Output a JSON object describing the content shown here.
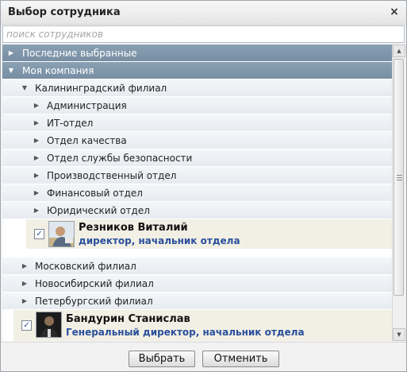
{
  "dialog": {
    "title": "Выбор сотрудника",
    "close_glyph": "×"
  },
  "search": {
    "placeholder": "поиск сотрудников",
    "value": ""
  },
  "tree": {
    "recent": {
      "label": "Последние выбранные",
      "expanded": false
    },
    "company": {
      "label": "Моя компания",
      "expanded": true
    },
    "kaliningrad": {
      "label": "Калининградский филиал",
      "expanded": true,
      "departments": [
        {
          "label": "Администрация"
        },
        {
          "label": "ИТ-отдел"
        },
        {
          "label": "Отдел качества"
        },
        {
          "label": "Отдел службы безопасности"
        },
        {
          "label": "Производственный отдел"
        },
        {
          "label": "Финансовый отдел"
        },
        {
          "label": "Юридический отдел"
        }
      ],
      "head": {
        "name": "Резников Виталий",
        "position": "директор, начальник отдела",
        "checked": true
      }
    },
    "branches": [
      {
        "label": "Московский филиал"
      },
      {
        "label": "Новосибирский филиал"
      },
      {
        "label": "Петербургский филиал"
      }
    ],
    "company_head": {
      "name": "Бандурин Станислав",
      "position": "Генеральный директор, начальник отдела",
      "checked": true
    }
  },
  "footer": {
    "select_label": "Выбрать",
    "cancel_label": "Отменить"
  },
  "icons": {
    "collapsed": "▶",
    "expanded": "▼",
    "checkmark": "✓"
  },
  "colors": {
    "section_header": "#778ea3",
    "position_text": "#2a4f9c",
    "selected_row": "#f2f0e4"
  }
}
